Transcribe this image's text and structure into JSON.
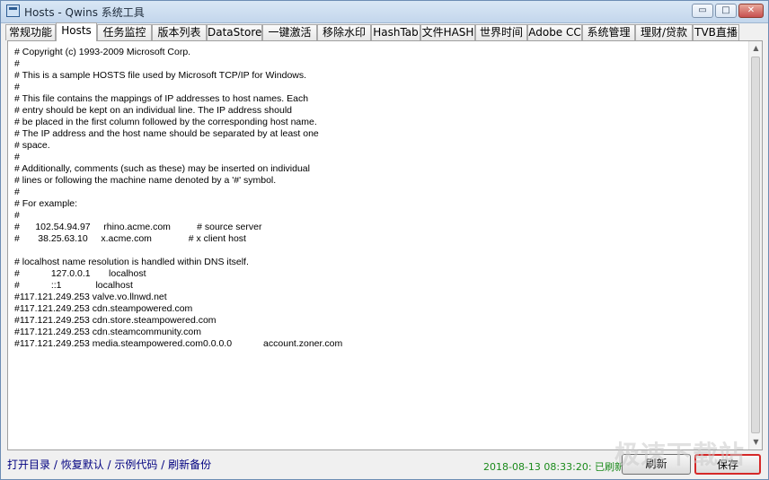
{
  "window": {
    "title": "Hosts - Qwins 系统工具",
    "controls": {
      "minimize": "▭",
      "maximize": "□",
      "close": "✕"
    }
  },
  "tabs": [
    {
      "label": "常规功能"
    },
    {
      "label": "Hosts"
    },
    {
      "label": "任务监控"
    },
    {
      "label": "版本列表"
    },
    {
      "label": "DataStore"
    },
    {
      "label": "一键激活"
    },
    {
      "label": "移除水印"
    },
    {
      "label": "HashTab"
    },
    {
      "label": "文件HASH"
    },
    {
      "label": "世界时间"
    },
    {
      "label": "Adobe CC"
    },
    {
      "label": "系统管理"
    },
    {
      "label": "理财/贷款"
    },
    {
      "label": "TVB直播"
    }
  ],
  "active_tab": "Hosts",
  "editor": {
    "lines": [
      "# Copyright (c) 1993-2009 Microsoft Corp.",
      "#",
      "# This is a sample HOSTS file used by Microsoft TCP/IP for Windows.",
      "#",
      "# This file contains the mappings of IP addresses to host names. Each",
      "# entry should be kept on an individual line. The IP address should",
      "# be placed in the first column followed by the corresponding host name.",
      "# The IP address and the host name should be separated by at least one",
      "# space.",
      "#",
      "# Additionally, comments (such as these) may be inserted on individual",
      "# lines or following the machine name denoted by a '#' symbol.",
      "#",
      "# For example:",
      "#",
      "#      102.54.94.97     rhino.acme.com          # source server",
      "#       38.25.63.10     x.acme.com              # x client host",
      "",
      "# localhost name resolution is handled within DNS itself.",
      "#            127.0.0.1       localhost",
      "#            ::1             localhost",
      "#117.121.249.253 valve.vo.llnwd.net",
      "#117.121.249.253 cdn.steampowered.com",
      "#117.121.249.253 cdn.store.steampowered.com",
      "#117.121.249.253 cdn.steamcommunity.com",
      "#117.121.249.253 media.steampowered.com0.0.0.0            account.zoner.com"
    ]
  },
  "footer": {
    "links": [
      "打开目录",
      "恢复默认",
      "示例代码",
      "刷新备份"
    ],
    "separator": " / ",
    "status": "2018-08-13 08:33:20: 已刷新",
    "refresh_label": "刷新",
    "save_label": "保存"
  },
  "watermark": "极速下载站",
  "colors": {
    "save_highlight": "#d62828",
    "status_text": "#1a8a1a",
    "link_text": "#000080"
  },
  "icons": {
    "app": "app-window-icon",
    "scroll_up": "▲",
    "scroll_down": "▼"
  }
}
